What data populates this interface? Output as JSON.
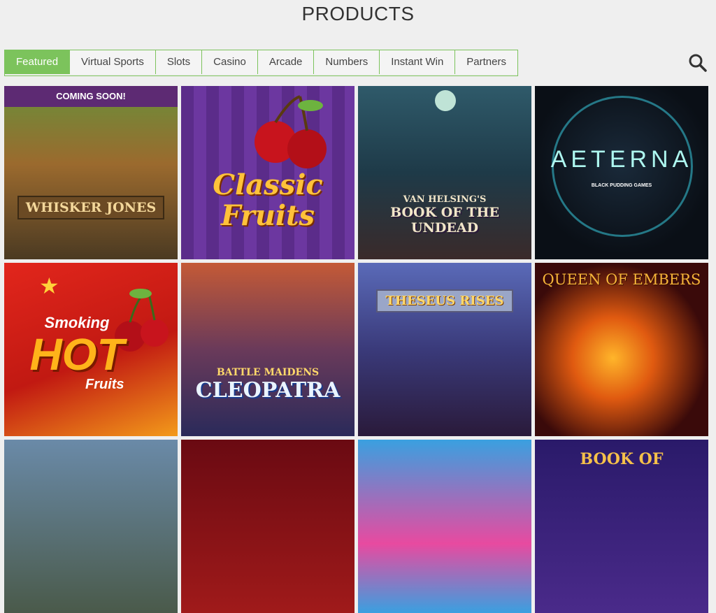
{
  "page": {
    "title": "PRODUCTS"
  },
  "tabs": [
    {
      "label": "Featured",
      "active": true
    },
    {
      "label": "Virtual Sports"
    },
    {
      "label": "Slots"
    },
    {
      "label": "Casino"
    },
    {
      "label": "Arcade"
    },
    {
      "label": "Numbers"
    },
    {
      "label": "Instant Win"
    },
    {
      "label": "Partners"
    }
  ],
  "search": {
    "icon": "search-icon"
  },
  "colors": {
    "accent": "#7cc35c",
    "background": "#efefef"
  },
  "games": [
    {
      "banner": "COMING SOON!",
      "name": "WHISKER JONES"
    },
    {
      "name": "Classic Fruits"
    },
    {
      "subtitle": "VAN HELSING'S",
      "name": "BOOK OF THE UNDEAD"
    },
    {
      "name": "AETERNA",
      "publisher": "BLACK PUDDING GAMES"
    },
    {
      "line1": "Smoking",
      "line2": "HOT",
      "line3": "Fruits"
    },
    {
      "subtitle": "BATTLE MAIDENS",
      "name": "CLEOPATRA"
    },
    {
      "name": "THESEUS RISES"
    },
    {
      "name": "QUEEN OF EMBERS"
    },
    {},
    {},
    {},
    {
      "name": "BOOK OF"
    }
  ]
}
